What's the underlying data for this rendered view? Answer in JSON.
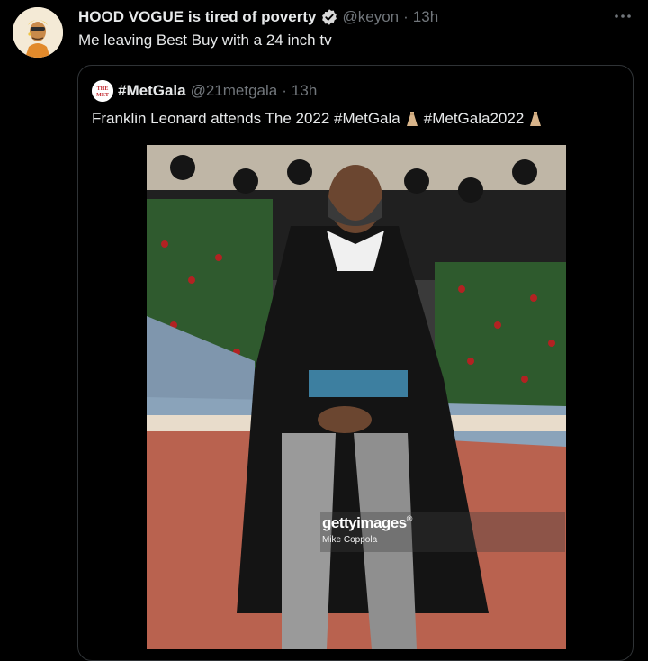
{
  "tweet": {
    "display_name": "HOOD VOGUE is tired of poverty",
    "handle": "@keyon",
    "separator": "·",
    "time": "13h",
    "text": "Me leaving Best Buy with a 24 inch tv",
    "avatar_icon": "cartoon-avatar-icon",
    "verified_icon": "verified-badge-icon",
    "more_icon": "more-options-icon"
  },
  "quoted_tweet": {
    "display_name": "#MetGala",
    "handle": "@21metgala",
    "separator": "·",
    "time": "13h",
    "text_part1": "Franklin Leonard attends The 2022 #MetGala",
    "text_part2": "#MetGala2022",
    "avatar_text": "THE MET",
    "emoji_icon": "dress-emoji-icon",
    "photo": {
      "watermark": "gettyimages",
      "watermark_mark": "®",
      "credit": "Mike Coppola"
    }
  },
  "colors": {
    "background": "#000000",
    "text_primary": "#e7e9ea",
    "text_secondary": "#71767b",
    "border": "#2f3336",
    "verified": "#d9d9d9",
    "met_red": "#c0262d"
  }
}
